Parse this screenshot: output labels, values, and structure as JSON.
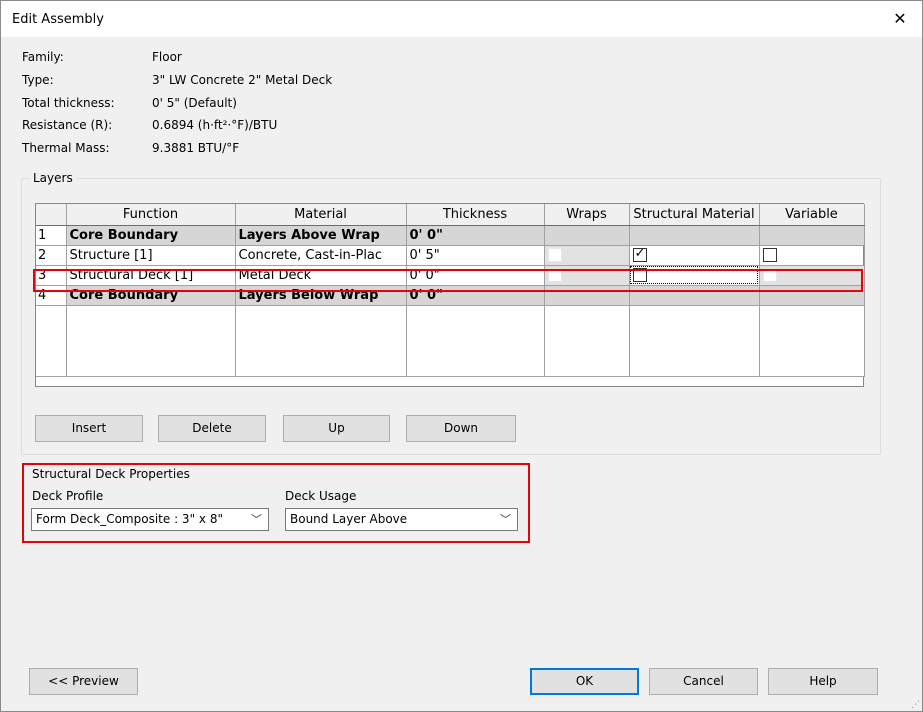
{
  "window": {
    "title": "Edit Assembly",
    "close_symbol": "✕"
  },
  "properties": [
    {
      "label": "Family:",
      "value": "Floor"
    },
    {
      "label": "Type:",
      "value": "3\" LW Concrete 2\" Metal Deck"
    },
    {
      "label": "Total thickness:",
      "value": "0'  5\" (Default)"
    },
    {
      "label": "Resistance (R):",
      "value": "0.6894 (h·ft²·°F)/BTU"
    },
    {
      "label": "Thermal Mass:",
      "value": "9.3881 BTU/°F"
    }
  ],
  "layers": {
    "legend": "Layers",
    "columns": [
      "",
      "Function",
      "Material",
      "Thickness",
      "Wraps",
      "Structural Material",
      "Variable"
    ],
    "rows": [
      {
        "num": "1",
        "function": "Core Boundary",
        "material": "Layers Above Wrap",
        "thickness": "0'  0\""
      },
      {
        "num": "2",
        "function": "Structure [1]",
        "material": "Concrete, Cast-in-Plac",
        "thickness": "0'  5\""
      },
      {
        "num": "3",
        "function": "Structural Deck [1]",
        "material": "Metal Deck",
        "thickness": "0'  0\""
      },
      {
        "num": "4",
        "function": "Core Boundary",
        "material": "Layers Below Wrap",
        "thickness": "0'  0\""
      }
    ],
    "checks": {
      "row2_structural_material": true,
      "row2_variable": false,
      "row3_structural_material": false
    }
  },
  "layer_buttons": {
    "insert": "Insert",
    "delete": "Delete",
    "up": "Up",
    "down": "Down"
  },
  "deck": {
    "title": "Structural Deck Properties",
    "profile_label": "Deck Profile",
    "profile_value": "Form Deck_Composite : 3\" x 8\"",
    "usage_label": "Deck Usage",
    "usage_value": "Bound Layer Above"
  },
  "footer": {
    "preview": "<< Preview",
    "ok": "OK",
    "cancel": "Cancel",
    "help": "Help"
  },
  "colors": {
    "highlight": "#e8000f",
    "default_button_border": "#0078d7"
  }
}
